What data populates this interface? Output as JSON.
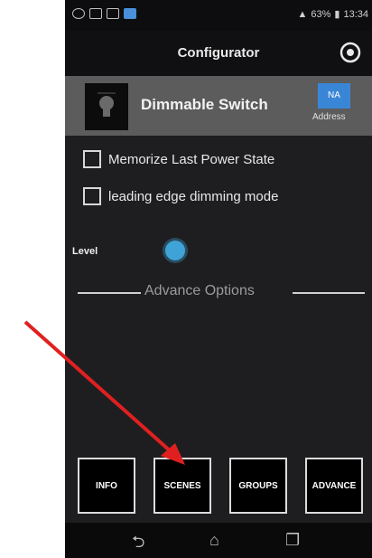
{
  "statusbar": {
    "battery": "63%",
    "time": "13:34"
  },
  "header": {
    "title": "Configurator",
    "settings_icon": "gear-icon"
  },
  "device": {
    "name": "Dimmable Switch",
    "address_value": "NA",
    "address_label": "Address"
  },
  "options": [
    {
      "label": "Memorize Last Power State",
      "checked": false
    },
    {
      "label": "leading edge dimming mode",
      "checked": false
    }
  ],
  "level": {
    "label": "Level"
  },
  "advance": {
    "heading": "Advance Options"
  },
  "buttons": {
    "info": "INFO",
    "scenes": "SCENES",
    "groups": "GROUPS",
    "advance": "ADVANCE"
  },
  "navbar": {
    "back_icon": "back-icon",
    "home_icon": "home-icon",
    "recents_icon": "recents-icon"
  },
  "colors": {
    "accent": "#3a86d6",
    "annotation_arrow": "#e02020"
  }
}
